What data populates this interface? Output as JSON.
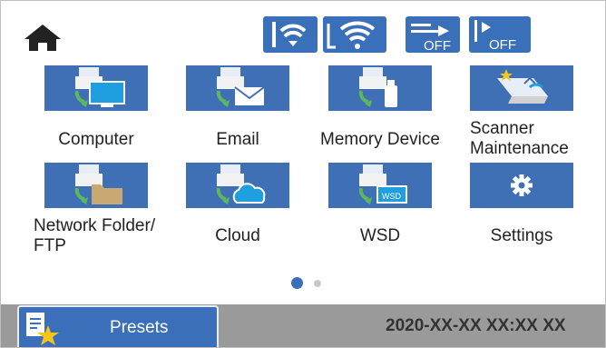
{
  "topbar": {
    "icons": [
      "home-icon",
      "wifi-direct-icon",
      "wifi-icon",
      "data-transfer-off-icon",
      "ethernet-off-icon"
    ],
    "off_label_1": "OFF",
    "off_label_2": "OFF"
  },
  "tiles": [
    {
      "label": "Computer",
      "icon": "computer-scan-icon"
    },
    {
      "label": "Email",
      "icon": "email-scan-icon"
    },
    {
      "label": "Memory Device",
      "icon": "memory-device-scan-icon"
    },
    {
      "label_line1": "Scanner",
      "label_line2": "Maintenance",
      "icon": "scanner-maintenance-icon"
    },
    {
      "label_line1": "Network Folder/",
      "label_line2": "FTP",
      "icon": "network-folder-icon"
    },
    {
      "label": "Cloud",
      "icon": "cloud-scan-icon"
    },
    {
      "label": "WSD",
      "icon": "wsd-scan-icon",
      "badge": "WSD"
    },
    {
      "label": "Settings",
      "icon": "settings-gear-icon"
    }
  ],
  "pagination": {
    "current_page": 1,
    "total_pages": 2
  },
  "footer": {
    "presets_label": "Presets",
    "datetime": "2020-XX-XX XX:XX XX"
  },
  "colors": {
    "tile_blue": "#3f6fb5",
    "footer_gray": "#9a9a9a",
    "active_dot": "#3b6fba",
    "inactive_dot": "#c9c9c9"
  }
}
